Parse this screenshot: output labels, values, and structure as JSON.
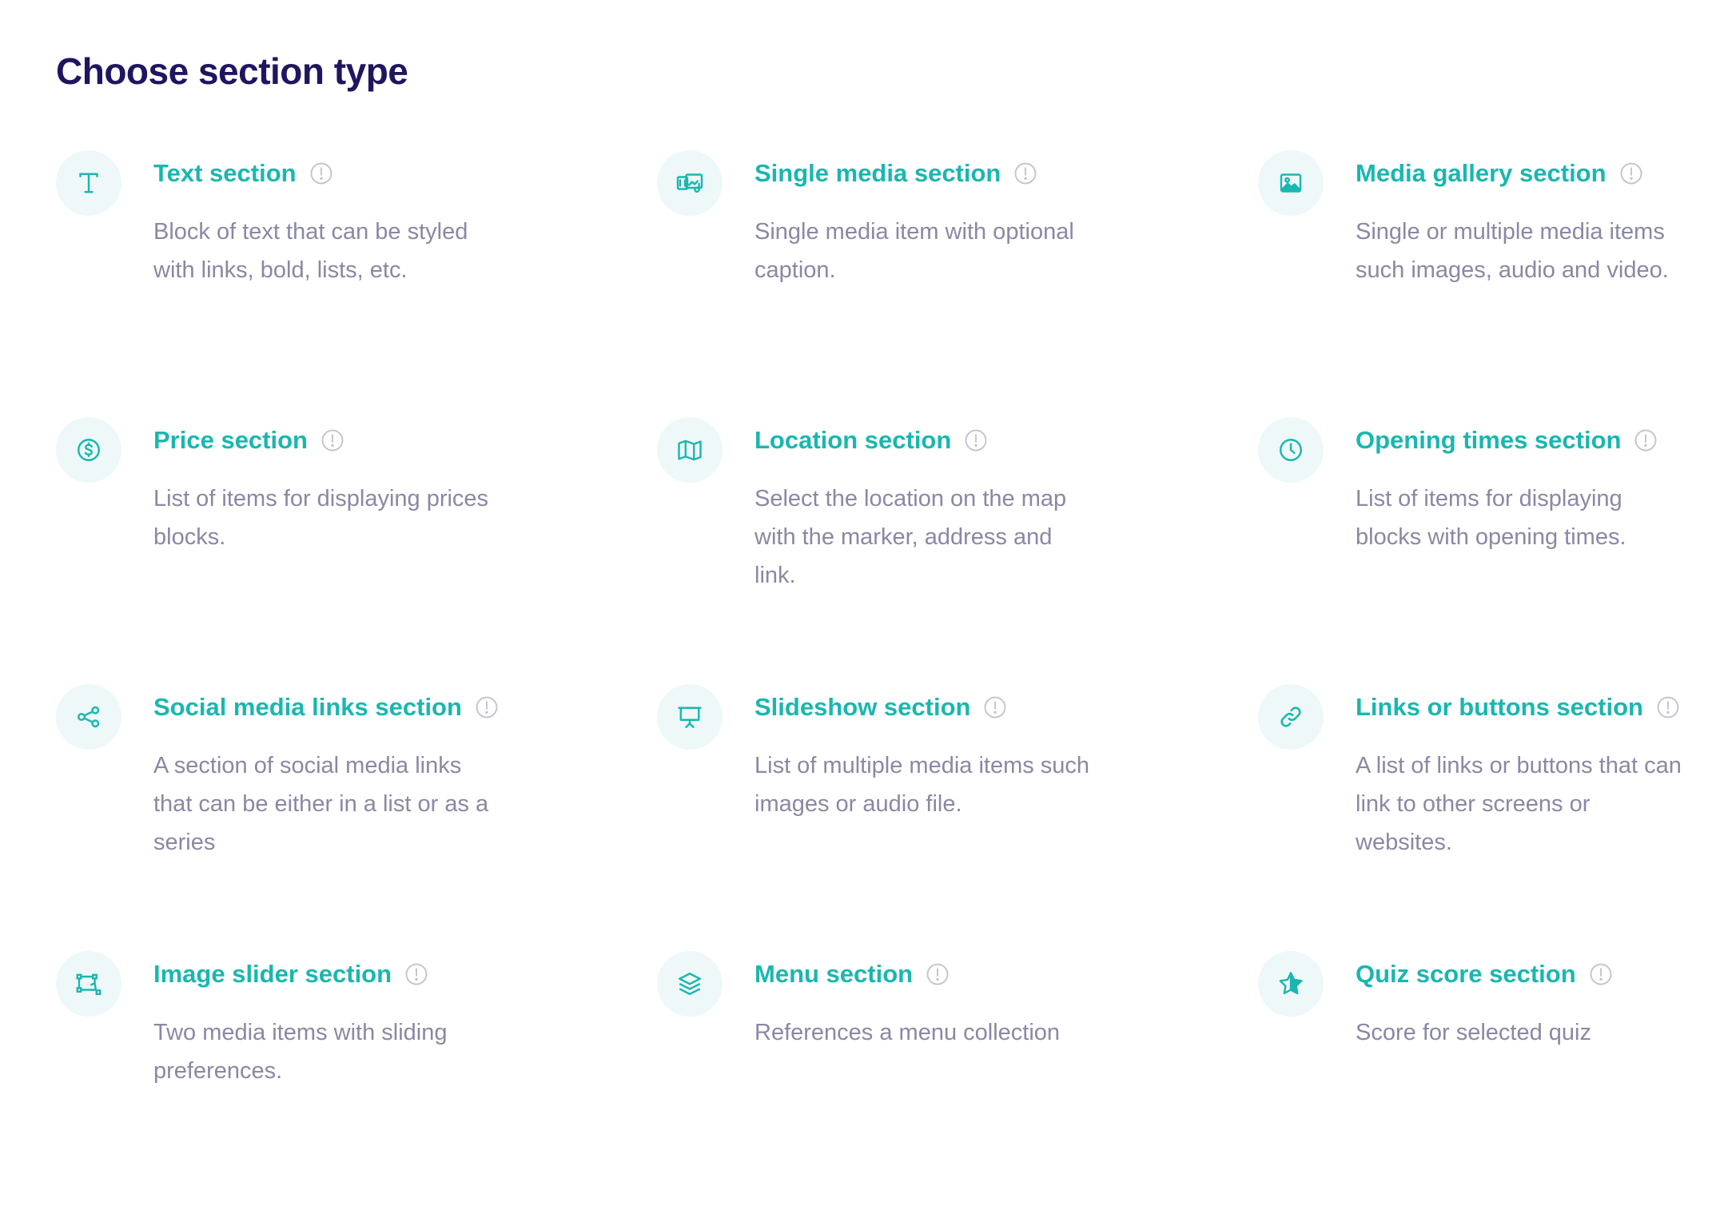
{
  "page": {
    "title": "Choose section type"
  },
  "colors": {
    "title": "#1f1560",
    "accent": "#19b7b0",
    "description": "#8a88a4",
    "icon_background": "#eef8f8",
    "info_icon": "#c3c2cf"
  },
  "sections": [
    {
      "title": "Text section",
      "description": "Block of text that can be styled with links, bold, lists, etc.",
      "icon": "text-icon",
      "info_icon": "info-icon"
    },
    {
      "title": "Single media section",
      "description": "Single media item with optional caption.",
      "icon": "media-icon",
      "info_icon": "info-icon"
    },
    {
      "title": "Media gallery section",
      "description": "Single or multiple media items such images, audio and video.",
      "icon": "image-icon",
      "info_icon": "info-icon"
    },
    {
      "title": "Price section",
      "description": "List of items for displaying prices blocks.",
      "icon": "dollar-icon",
      "info_icon": "info-icon"
    },
    {
      "title": "Location section",
      "description": "Select the location on the map with the marker, address and link.",
      "icon": "map-icon",
      "info_icon": "info-icon"
    },
    {
      "title": "Opening times section",
      "description": "List of items for displaying blocks with opening times.",
      "icon": "clock-icon",
      "info_icon": "info-icon"
    },
    {
      "title": "Social media links section",
      "description": "A section of social media links that can be either in a list or as a series",
      "icon": "share-icon",
      "info_icon": "info-icon"
    },
    {
      "title": "Slideshow section",
      "description": "List of multiple media items such images or audio file.",
      "icon": "presentation-icon",
      "info_icon": "info-icon"
    },
    {
      "title": "Links or buttons section",
      "description": "A list of links or buttons that can link to other screens or websites.",
      "icon": "link-icon",
      "info_icon": "info-icon"
    },
    {
      "title": "Image slider section",
      "description": "Two media items with sliding preferences.",
      "icon": "slider-icon",
      "info_icon": "info-icon"
    },
    {
      "title": "Menu section",
      "description": "References a menu collection",
      "icon": "layers-icon",
      "info_icon": "info-icon"
    },
    {
      "title": "Quiz score section",
      "description": "Score for selected quiz",
      "icon": "star-icon",
      "info_icon": "info-icon"
    }
  ]
}
